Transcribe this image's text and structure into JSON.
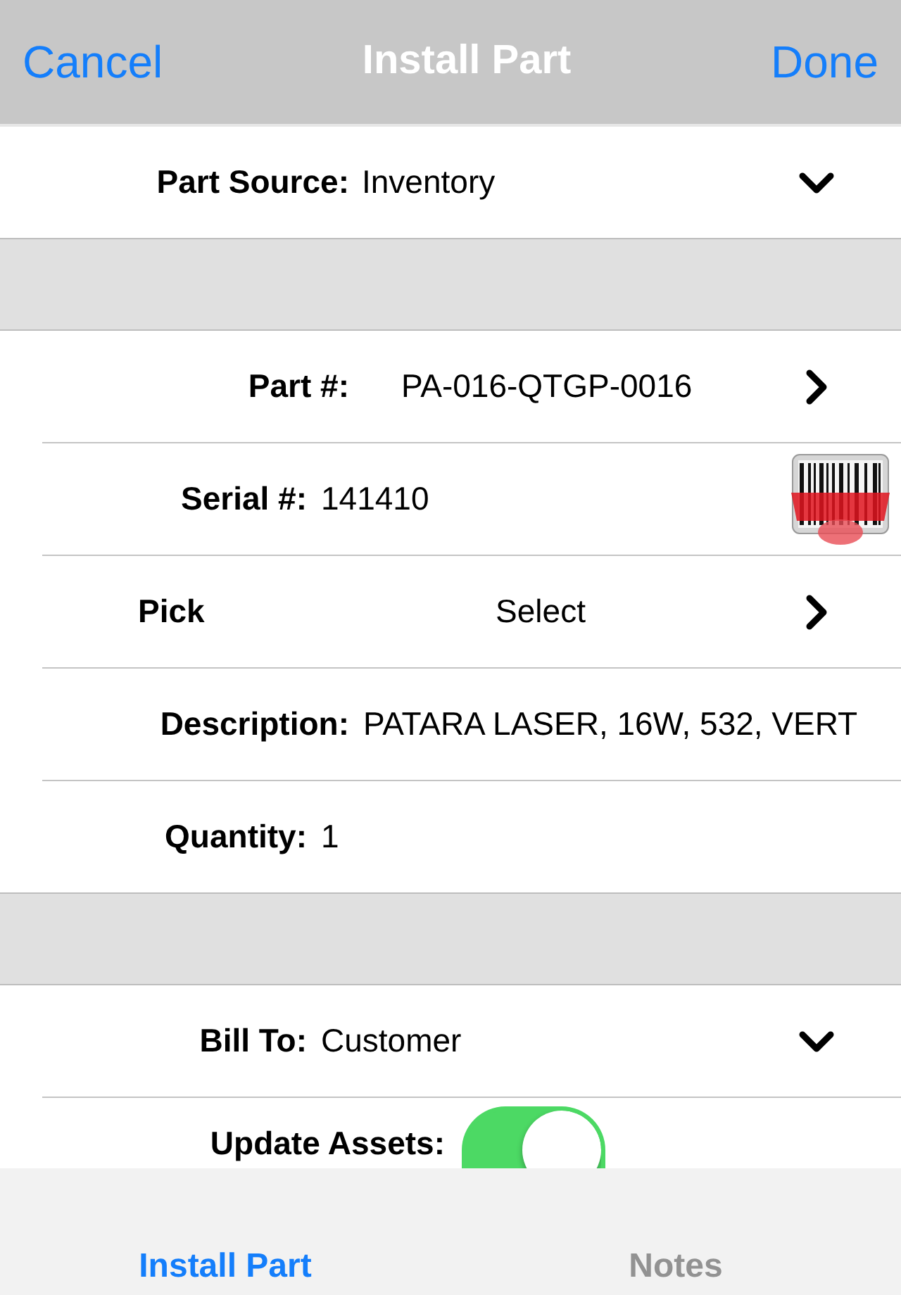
{
  "nav_bar": {
    "cancel": "Cancel",
    "title": "Install Part",
    "done": "Done"
  },
  "sections": [
    {
      "rows": [
        {
          "kind": "dropdown",
          "label": "Part Source:",
          "value": "Inventory"
        }
      ]
    },
    {
      "rows": [
        {
          "kind": "link",
          "label": "Part #:",
          "value": "PA-016-QTGP-0016"
        },
        {
          "kind": "scan",
          "label": "Serial #:",
          "value": "141410"
        },
        {
          "kind": "picker",
          "label": "Pick",
          "value": "Select"
        },
        {
          "kind": "text",
          "label": "Description:",
          "value": "PATARA LASER, 16W, 532, VERT"
        },
        {
          "kind": "text",
          "label": "Quantity:",
          "value": "1"
        }
      ]
    },
    {
      "rows": [
        {
          "kind": "dropdown",
          "label": "Bill To:",
          "value": "Customer"
        },
        {
          "kind": "toggle",
          "label": "Update Assets:",
          "on": true
        }
      ]
    }
  ],
  "tab_bar": {
    "tabs": [
      {
        "label": "Install Part",
        "selected": true
      },
      {
        "label": "Notes",
        "selected": false
      }
    ]
  }
}
